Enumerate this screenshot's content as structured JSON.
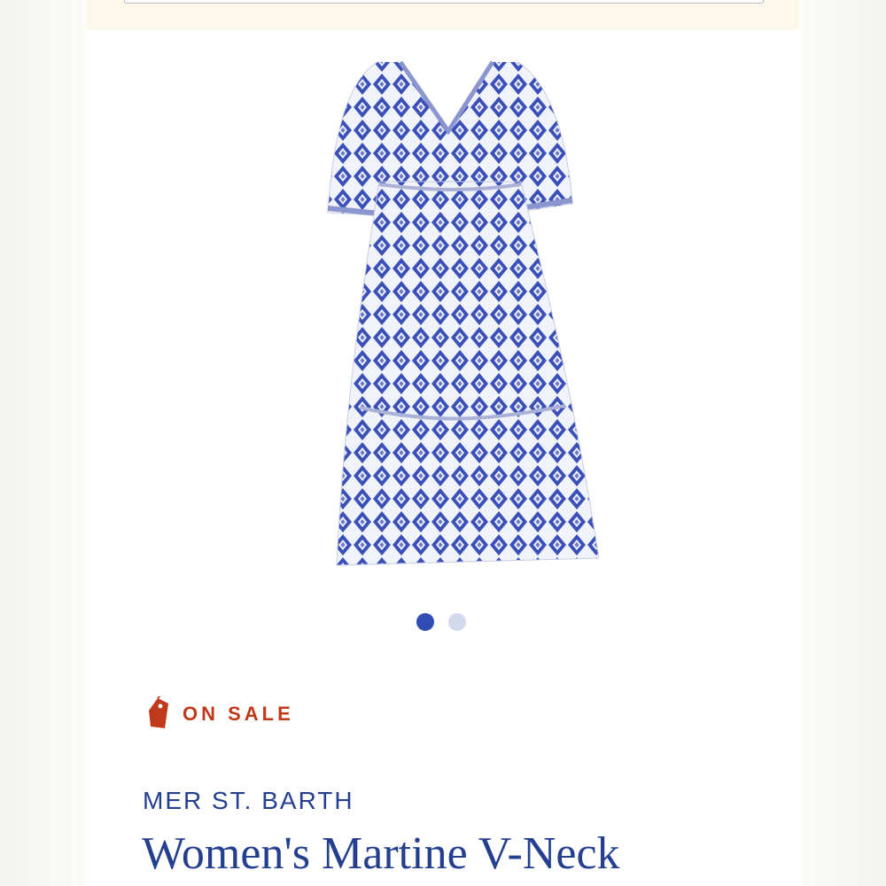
{
  "colors": {
    "accent": "#243f8f",
    "sale": "#c0391b",
    "dot_active": "#2f4db3",
    "dot_inactive": "#d3d9ec",
    "banner": "#fcf9ea"
  },
  "carousel": {
    "total_slides": 2,
    "active_index": 0
  },
  "product": {
    "image_icon": "dress-image",
    "sale_icon": "price-tag-icon",
    "sale_label": "ON SALE",
    "brand": "MER ST. BARTH",
    "title": "Women's Martine V-Neck"
  }
}
